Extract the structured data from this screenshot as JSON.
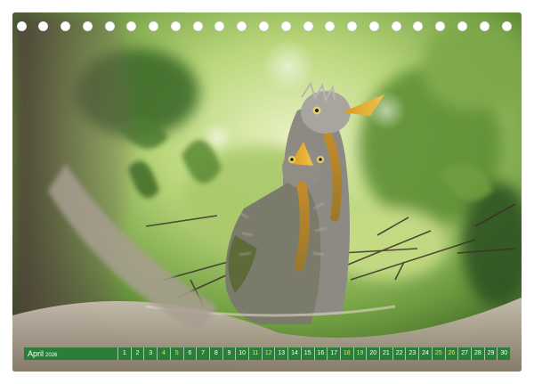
{
  "calendar": {
    "month": "April",
    "year": "2026",
    "days": [
      "1",
      "2",
      "3",
      "4",
      "5",
      "6",
      "7",
      "8",
      "9",
      "10",
      "11",
      "12",
      "13",
      "14",
      "15",
      "16",
      "17",
      "18",
      "19",
      "20",
      "21",
      "22",
      "23",
      "24",
      "25",
      "26",
      "27",
      "28",
      "29",
      "30"
    ],
    "weekend_days": [
      "4",
      "5",
      "11",
      "12",
      "18",
      "19",
      "25",
      "26"
    ],
    "accent_color": "#2d7d3a",
    "weekend_color": "#d9e84a"
  },
  "photo": {
    "subject_icon": "heron-chicks-in-nest"
  },
  "binding": {
    "hole_count": 23
  }
}
